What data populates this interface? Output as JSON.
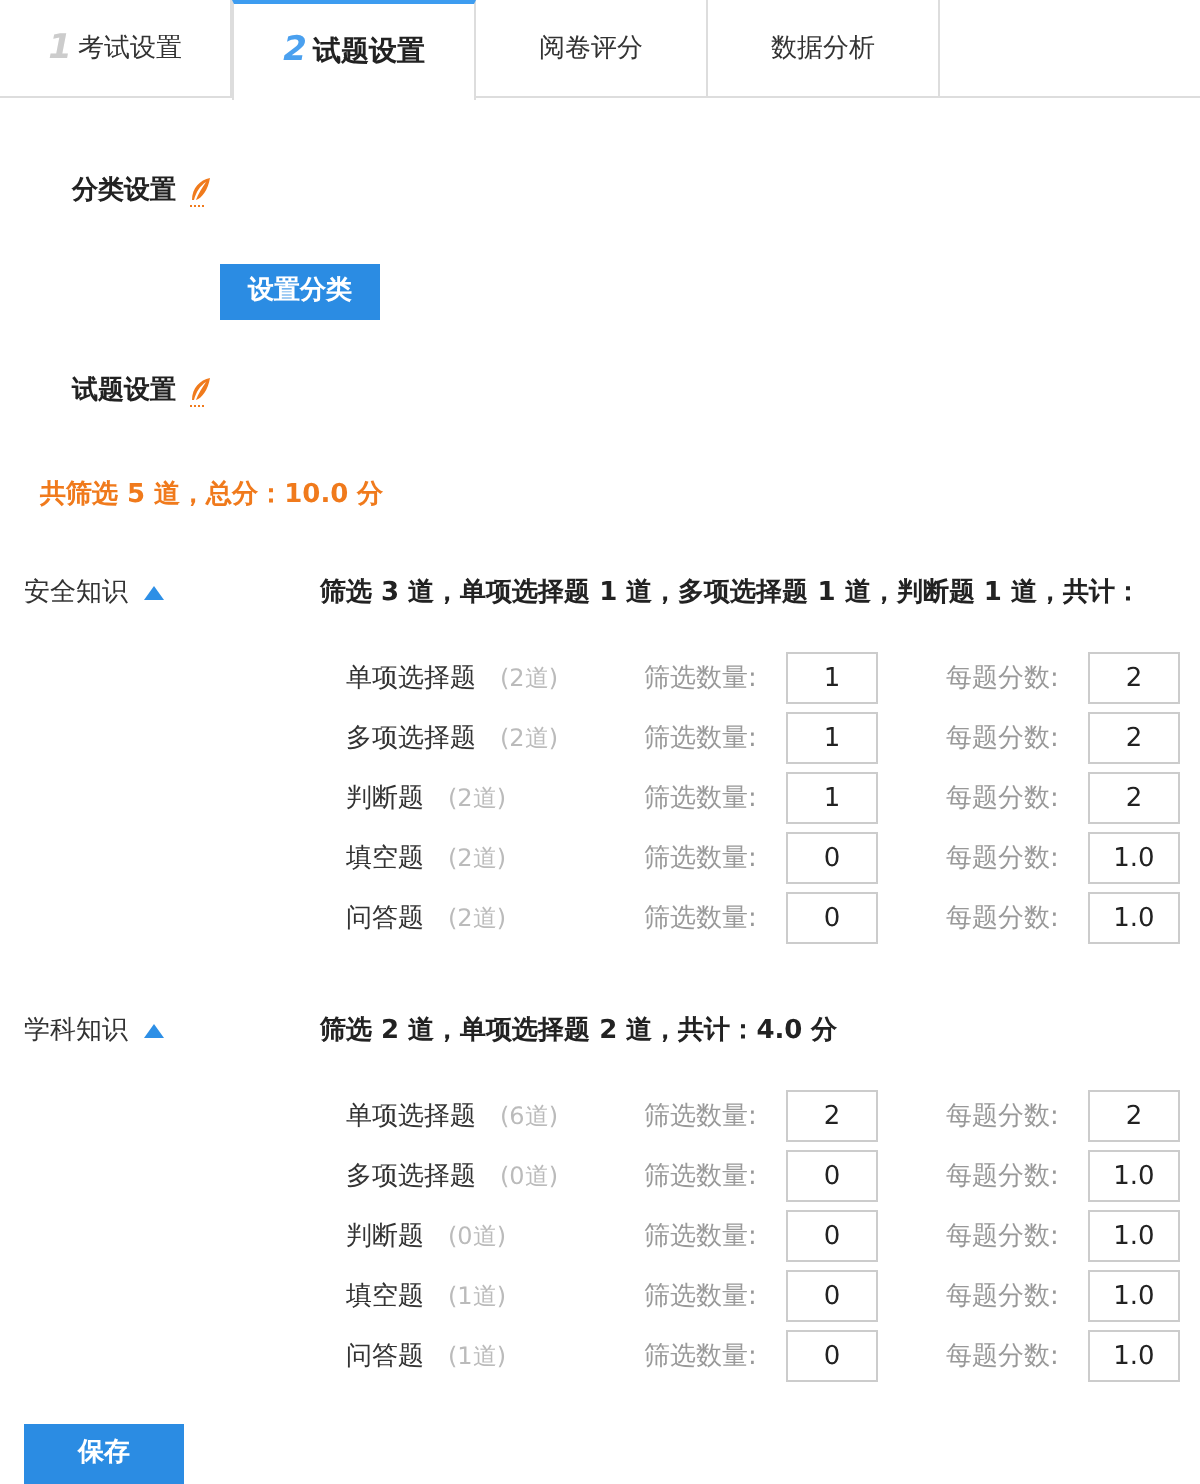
{
  "tabs": [
    {
      "number": "1",
      "label": "考试设置",
      "selected": false
    },
    {
      "number": "2",
      "label": "试题设置",
      "selected": true
    },
    {
      "label": "阅卷评分",
      "selected": false
    },
    {
      "label": "数据分析",
      "selected": false
    }
  ],
  "category_setting": {
    "title": "分类设置",
    "button": "设置分类"
  },
  "question_setting": {
    "title": "试题设置"
  },
  "total": "共筛选 5 道，总分：10.0 分",
  "sections": [
    {
      "name": "安全知识",
      "expanded": true,
      "summary": "筛选 3 道，单项选择题 1 道，多项选择题 1 道，判断题 1 道，共计：",
      "rows": [
        {
          "type": "单项选择题",
          "available": "(2道)",
          "count_label": "筛选数量:",
          "count": "1",
          "score_label": "每题分数:",
          "score": "2"
        },
        {
          "type": "多项选择题",
          "available": "(2道)",
          "count_label": "筛选数量:",
          "count": "1",
          "score_label": "每题分数:",
          "score": "2"
        },
        {
          "type": "判断题",
          "available": "(2道)",
          "count_label": "筛选数量:",
          "count": "1",
          "score_label": "每题分数:",
          "score": "2"
        },
        {
          "type": "填空题",
          "available": "(2道)",
          "count_label": "筛选数量:",
          "count": "0",
          "score_label": "每题分数:",
          "score": "1.0"
        },
        {
          "type": "问答题",
          "available": "(2道)",
          "count_label": "筛选数量:",
          "count": "0",
          "score_label": "每题分数:",
          "score": "1.0"
        }
      ]
    },
    {
      "name": "学科知识",
      "expanded": true,
      "summary": "筛选 2 道，单项选择题 2 道，共计：4.0 分",
      "rows": [
        {
          "type": "单项选择题",
          "available": "(6道)",
          "count_label": "筛选数量:",
          "count": "2",
          "score_label": "每题分数:",
          "score": "2"
        },
        {
          "type": "多项选择题",
          "available": "(0道)",
          "count_label": "筛选数量:",
          "count": "0",
          "score_label": "每题分数:",
          "score": "1.0"
        },
        {
          "type": "判断题",
          "available": "(0道)",
          "count_label": "筛选数量:",
          "count": "0",
          "score_label": "每题分数:",
          "score": "1.0"
        },
        {
          "type": "填空题",
          "available": "(1道)",
          "count_label": "筛选数量:",
          "count": "0",
          "score_label": "每题分数:",
          "score": "1.0"
        },
        {
          "type": "问答题",
          "available": "(1道)",
          "count_label": "筛选数量:",
          "count": "0",
          "score_label": "每题分数:",
          "score": "1.0"
        }
      ]
    }
  ],
  "save_button": "保存"
}
